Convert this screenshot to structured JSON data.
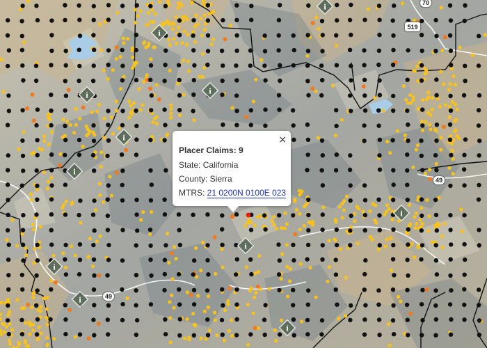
{
  "colors": {
    "terrain_base": "#a6a7a2",
    "terrain_light": "#c9c6b4",
    "terrain_warm": "#cbb48f",
    "shade": "#6f7c83",
    "water": "#a9cde6",
    "boundary": "#111111",
    "road": "#ffffff",
    "claim_black": "#111111",
    "claim_yellow": "#f7c21e",
    "claim_orange": "#ef7a24",
    "claim_red": "#e81919",
    "marker_fill": "#5f6e5c",
    "marker_stroke": "#e6e9e3"
  },
  "route_shields": [
    {
      "label": "70",
      "name": "route-70-shield"
    },
    {
      "label": "519",
      "name": "route-519-shield"
    },
    {
      "label": "49",
      "name": "route-49-shield-east"
    },
    {
      "label": "49",
      "name": "route-49-shield-west"
    }
  ],
  "marker_icon": "info-i-diamond-icon",
  "popup": {
    "title": "Placer Claims: 9",
    "state": "State: California",
    "county": "County: Sierra",
    "mtrs_label": "MTRS: ",
    "mtrs_link": "21 0200N 0100E 023",
    "close": "×"
  }
}
